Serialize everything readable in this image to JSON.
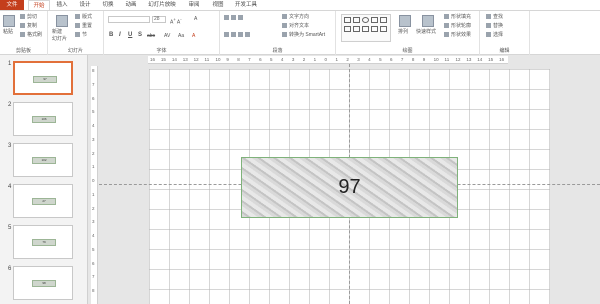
{
  "tabs": [
    "文件",
    "开始",
    "插入",
    "设计",
    "切换",
    "动画",
    "幻灯片放映",
    "审阅",
    "视图",
    "开发工具"
  ],
  "clipboard": {
    "paste": "粘贴",
    "cut": "剪切",
    "copy": "复制",
    "format_painter": "格式刷",
    "group": "剪贴板"
  },
  "slides_group": {
    "new_slide": "新建\n幻灯片",
    "layout": "版式",
    "reset": "重置",
    "section": "节",
    "group": "幻灯片"
  },
  "font_group": {
    "font_size": "28",
    "bold": "B",
    "italic": "I",
    "underline": "U",
    "shadow": "S",
    "strike": "abc",
    "group": "字体"
  },
  "paragraph_group": {
    "text_direction": "文字方向",
    "align_text": "对齐文本",
    "smartart": "转换为 SmartArt",
    "group": "段落"
  },
  "drawing_group": {
    "arrange": "排列",
    "quick_styles": "快速样式",
    "shape_fill": "形状填充",
    "shape_outline": "形状轮廓",
    "shape_effects": "形状效果",
    "group": "绘图"
  },
  "editing_group": {
    "find": "查找",
    "replace": "替换",
    "select": "选择",
    "group": "编辑"
  },
  "thumbnails": [
    {
      "num": "1",
      "value": "97"
    },
    {
      "num": "2",
      "value": "106"
    },
    {
      "num": "3",
      "value": "102"
    },
    {
      "num": "4",
      "value": "27"
    },
    {
      "num": "5",
      "value": "79"
    },
    {
      "num": "6",
      "value": "98"
    }
  ],
  "ruler_h": [
    "16",
    "15",
    "14",
    "13",
    "12",
    "11",
    "10",
    "9",
    "8",
    "7",
    "6",
    "5",
    "4",
    "3",
    "2",
    "1",
    "0",
    "1",
    "2",
    "3",
    "4",
    "5",
    "6",
    "7",
    "8",
    "9",
    "10",
    "11",
    "12",
    "13",
    "14",
    "15",
    "16"
  ],
  "ruler_v": [
    "8",
    "7",
    "6",
    "5",
    "4",
    "3",
    "2",
    "1",
    "0",
    "1",
    "2",
    "3",
    "4",
    "5",
    "6",
    "7",
    "8"
  ],
  "slide": {
    "textbox_value": "97"
  }
}
